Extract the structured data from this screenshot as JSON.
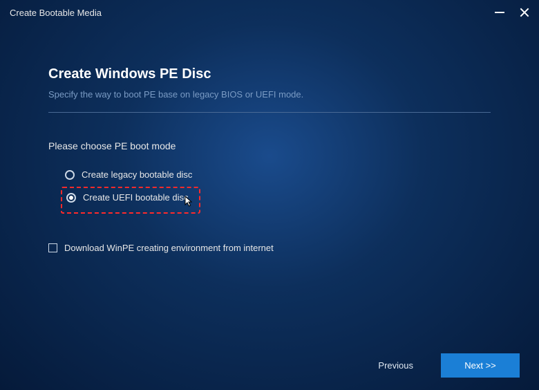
{
  "window": {
    "title": "Create Bootable Media"
  },
  "header": {
    "title": "Create Windows PE Disc",
    "subtitle": "Specify the way to boot PE base on legacy BIOS or UEFI mode."
  },
  "bootMode": {
    "label": "Please choose PE boot mode",
    "options": {
      "legacy": {
        "label": "Create legacy bootable disc",
        "selected": false
      },
      "uefi": {
        "label": "Create UEFI bootable disc",
        "selected": true
      }
    }
  },
  "download": {
    "label": "Download WinPE creating environment from internet",
    "checked": false
  },
  "footer": {
    "previous": "Previous",
    "next": "Next >>"
  },
  "colors": {
    "accent": "#1b7fd6",
    "highlight": "#ff2a2a"
  }
}
